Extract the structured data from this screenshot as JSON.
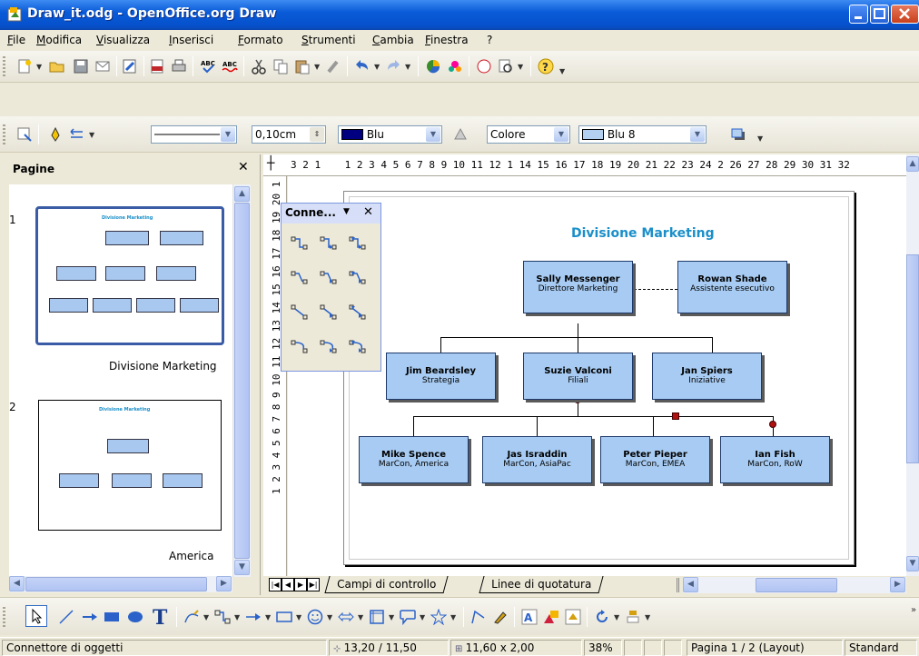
{
  "window": {
    "title": "Draw_it.odg - OpenOffice.org Draw"
  },
  "menu": [
    "File",
    "Modifica",
    "Visualizza",
    "Inserisci",
    "Formato",
    "Strumenti",
    "Cambia",
    "Finestra",
    "?"
  ],
  "line_toolbar": {
    "line_width": "0,10cm",
    "line_color": "Blu",
    "area_style": "Colore",
    "area_color": "Blu 8",
    "colors": {
      "blu": "#000080",
      "blu8": "#b4d0f0"
    }
  },
  "panel": {
    "title": "Pagine",
    "slides": [
      {
        "number": "1",
        "name": "Divisione Marketing",
        "thumb_title": "Divisione Marketing"
      },
      {
        "number": "2",
        "name": "America",
        "thumb_title": "Divisione Marketing"
      }
    ]
  },
  "ruler": {
    "h_ticks": "3 2 1    1 2 3 4 5 6 7 8 9 10 11 12 1 14 15 16 17 18 19 20 21 22 23 24 2 26 27 28 29 30 31 32",
    "v_ticks": "1 2 3 4 5 6 7 8 9 10 11 12 13 14 15 16 17 18 19 20 1"
  },
  "connector_toolbar": {
    "title": "Conne..."
  },
  "chart": {
    "title": "Divisione Marketing",
    "nodes": [
      {
        "name": "Sally Messenger",
        "role": "Direttore Marketing"
      },
      {
        "name": "Rowan Shade",
        "role": "Assistente esecutivo"
      },
      {
        "name": "Jim Beardsley",
        "role": "Strategia"
      },
      {
        "name": "Suzie Valconi",
        "role": "Filiali"
      },
      {
        "name": "Jan Spiers",
        "role": "Iniziative"
      },
      {
        "name": "Mike Spence",
        "role": "MarCon, America"
      },
      {
        "name": "Jas Israddin",
        "role": "MarCon, AsiaPac"
      },
      {
        "name": "Peter Pieper",
        "role": "MarCon, EMEA"
      },
      {
        "name": "Ian Fish",
        "role": "MarCon, RoW"
      }
    ]
  },
  "tabs": [
    "Campi di controllo",
    "Linee di quotatura"
  ],
  "status": {
    "object": "Connettore di oggetti",
    "position": "13,20 / 11,50",
    "size": "11,60 x 2,00",
    "zoom": "38%",
    "page": "Pagina 1 / 2 (Layout)",
    "style": "Standard"
  }
}
